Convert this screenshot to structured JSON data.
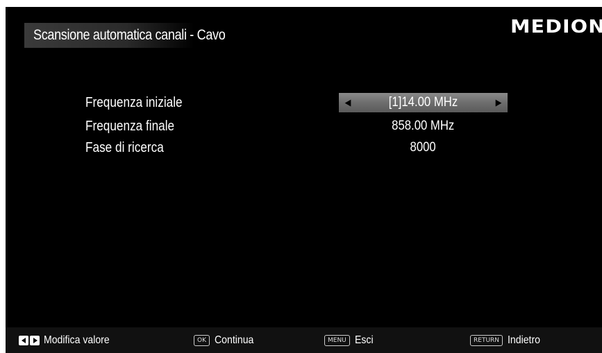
{
  "header": {
    "title": "Scansione automatica canali - Cavo",
    "logo": "MEDION"
  },
  "settings": [
    {
      "label": "Frequenza iniziale",
      "value": "[1]14.00 MHz",
      "selected": true
    },
    {
      "label": "Frequenza finale",
      "value": "858.00 MHz",
      "selected": false
    },
    {
      "label": "Fase di ricerca",
      "value": "8000",
      "selected": false
    }
  ],
  "arrows": {
    "left": "◀",
    "right": "▶"
  },
  "footer": {
    "modify_label": "Modifica valore",
    "ok_key": "OK",
    "ok_label": "Continua",
    "menu_key": "MENU",
    "menu_label": "Esci",
    "return_key": "RETURN",
    "return_label": "Indietro"
  },
  "colors": {
    "background": "#000000",
    "text": "#ffffff",
    "selected_bar": "#7a7a7a"
  }
}
